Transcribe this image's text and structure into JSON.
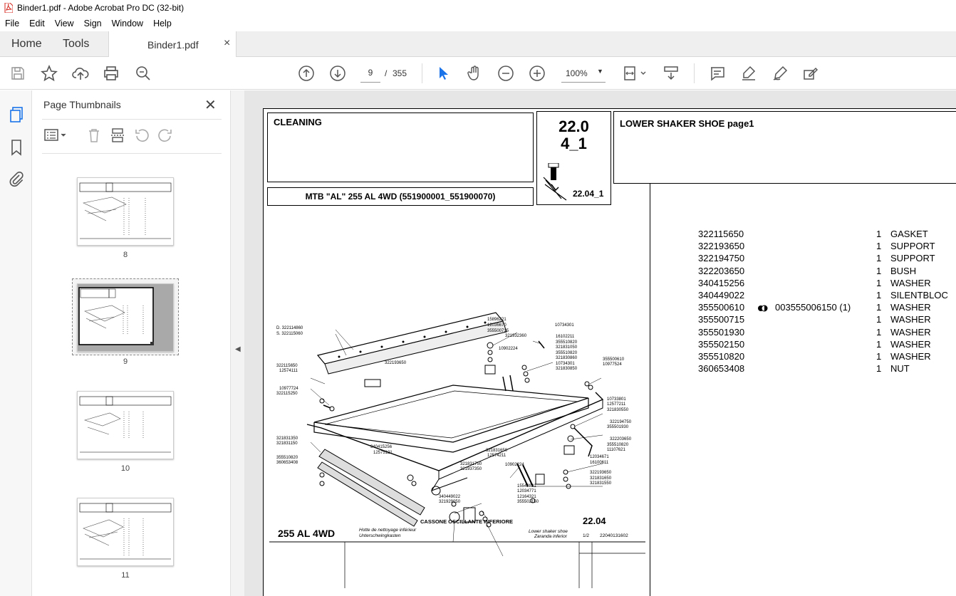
{
  "window": {
    "title": "Binder1.pdf - Adobe Acrobat Pro DC (32-bit)"
  },
  "menu": [
    "File",
    "Edit",
    "View",
    "Sign",
    "Window",
    "Help"
  ],
  "tabs": {
    "home": "Home",
    "tools": "Tools",
    "document": "Binder1.pdf",
    "close_glyph": "×"
  },
  "toolbar": {
    "page_current": "9",
    "page_separator": "/",
    "page_total": "355",
    "zoom": "100%",
    "icons": [
      "save-icon",
      "bookmark-star-icon",
      "upload-icon",
      "print-icon",
      "search-zoom-icon",
      "page-up-icon",
      "page-down-icon",
      "select-cursor-icon",
      "hand-icon",
      "zoom-out-icon",
      "zoom-in-icon",
      "page-fit-icon",
      "scroll-mode-icon",
      "comment-icon",
      "highlight-icon",
      "draw-icon",
      "fill-sign-icon"
    ]
  },
  "sidebar": {
    "title": "Page Thumbnails",
    "close_glyph": "✕",
    "thumbnails": [
      {
        "page": "8"
      },
      {
        "page": "9",
        "selected": true
      },
      {
        "page": "10"
      },
      {
        "page": "11"
      }
    ]
  },
  "document": {
    "section": "CLEANING",
    "code_line1": "22.0",
    "code_line2": "4_1",
    "code_small": "22.04_1",
    "subtitle": "LOWER SHAKER SHOE  page1",
    "model": "MTB \"AL\" 255 AL 4WD (551900001_551900070)",
    "parts": [
      {
        "num": "322115650",
        "alt": "",
        "qty": "1",
        "desc": "GASKET"
      },
      {
        "num": "322193650",
        "alt": "",
        "qty": "1",
        "desc": "SUPPORT"
      },
      {
        "num": "322194750",
        "alt": "",
        "qty": "1",
        "desc": "SUPPORT"
      },
      {
        "num": "322203650",
        "alt": "",
        "qty": "1",
        "desc": "BUSH"
      },
      {
        "num": "340415256",
        "alt": "",
        "qty": "1",
        "desc": "WASHER"
      },
      {
        "num": "340449022",
        "alt": "",
        "qty": "1",
        "desc": "SILENTBLOC"
      },
      {
        "num": "355500610",
        "alt": "003555006150  (1)",
        "qty": "1",
        "desc": "WASHER"
      },
      {
        "num": "355500715",
        "alt": "",
        "qty": "1",
        "desc": "WASHER"
      },
      {
        "num": "355501930",
        "alt": "",
        "qty": "1",
        "desc": "WASHER"
      },
      {
        "num": "355502150",
        "alt": "",
        "qty": "1",
        "desc": "WASHER"
      },
      {
        "num": "355510820",
        "alt": "",
        "qty": "1",
        "desc": "WASHER"
      },
      {
        "num": "360653408",
        "alt": "",
        "qty": "1",
        "desc": "NUT"
      }
    ],
    "drawing": {
      "footer_model": "255 AL 4WD",
      "footer_title_it": "CASSONE OSCILLANTE INFERIORE",
      "footer_title_fr": "Hotte de nettoyage inférieur",
      "footer_title_de": "Unterschwingkasten",
      "footer_title_en": "Lower shaker shoe",
      "footer_title_es": "Zaranda inferior",
      "footer_code": "22.04",
      "footer_sheet": "1/2",
      "footer_ref": "22040131602",
      "callouts_left": [
        "D. 322114860",
        "S. 322115060",
        "322115650",
        "12574111",
        "10977724",
        "322115250",
        "321831350",
        "321831150",
        "355510820",
        "360653408"
      ],
      "callouts_top": [
        "15896221",
        "12036670",
        "355500715",
        "321932360",
        "10734301",
        "16102211",
        "355510820",
        "321831050",
        "355510820",
        "321830860",
        "10734301",
        "321830850",
        "10902224",
        "355500610",
        "10977524"
      ],
      "callouts_center": [
        "322193650",
        "340415256",
        "12575121",
        "321831650",
        "12574211",
        "10902224",
        "321831750",
        "321937350",
        "15542821",
        "12034771",
        "12164321",
        "355502150",
        "340449022",
        "321929050"
      ],
      "callouts_right": [
        "10733801",
        "12577211",
        "321830550",
        "322194750",
        "355501930",
        "322203650",
        "355510820",
        "11107621",
        "12034671",
        "16100611",
        "322193650",
        "321831650",
        "321831550"
      ]
    }
  }
}
